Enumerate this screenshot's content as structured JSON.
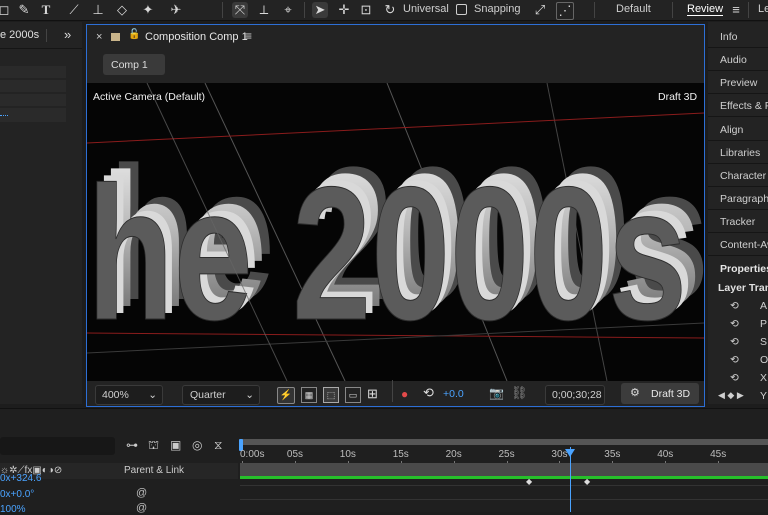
{
  "toolbar": {
    "universal_label": "Universal",
    "snapping_label": "Snapping",
    "workspace_default": "Default",
    "workspace_review": "Review",
    "workspace_more": "Le"
  },
  "project": {
    "tab_title": "e 2000s"
  },
  "comp": {
    "tab_title": "Composition Comp 1",
    "breadcrumb": "Comp 1",
    "camera_label": "Active Camera (Default)",
    "renderer_label": "Draft 3D",
    "headline_text": "he 2000s",
    "zoom": "400%",
    "resolution": "Quarter",
    "exposure": "+0.0",
    "timecode": "0;00;30;28",
    "draft3d_button": "Draft 3D"
  },
  "right_panel": {
    "items": [
      "Info",
      "Audio",
      "Preview",
      "Effects & P",
      "Align",
      "Libraries",
      "Character",
      "Paragraph",
      "Tracker",
      "Content-Aw"
    ],
    "properties_title": "Properties:",
    "layer_transform": "Layer Trans",
    "transform_rows": [
      "A",
      "P",
      "S",
      "O",
      "X"
    ],
    "last_row": "Y"
  },
  "timeline": {
    "ticks": [
      "0:00s",
      "05s",
      "10s",
      "15s",
      "20s",
      "25s",
      "30s",
      "35s",
      "40s",
      "45s"
    ],
    "column_parent_link": "Parent & Link",
    "value_rows": [
      "0x+324.6",
      "0x+0.0°",
      "100%"
    ],
    "playhead_seconds": 31
  },
  "colors": {
    "accent_blue": "#2d6fd6",
    "playhead": "#4aa3ff",
    "keyframe_bar": "#26c02a"
  }
}
